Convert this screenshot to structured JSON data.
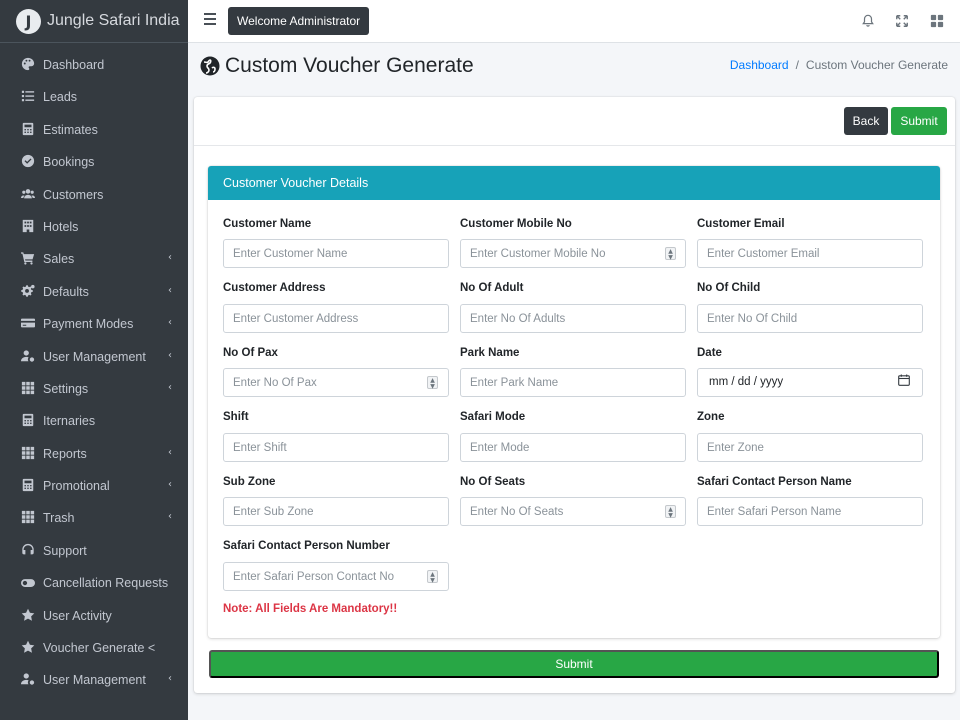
{
  "brand": {
    "logo_letter": "J",
    "name": "Jungle Safari India"
  },
  "sidebar": {
    "items": [
      {
        "label": "Dashboard",
        "icon": "palette-icon",
        "chevron": false
      },
      {
        "label": "Leads",
        "icon": "list-icon",
        "chevron": false
      },
      {
        "label": "Estimates",
        "icon": "calculator-icon",
        "chevron": false
      },
      {
        "label": "Bookings",
        "icon": "check-circle-icon",
        "chevron": false
      },
      {
        "label": "Customers",
        "icon": "users-icon",
        "chevron": false
      },
      {
        "label": "Hotels",
        "icon": "building-icon",
        "chevron": false
      },
      {
        "label": "Sales",
        "icon": "cart-icon",
        "chevron": true
      },
      {
        "label": "Defaults",
        "icon": "cogs-icon",
        "chevron": true
      },
      {
        "label": "Payment Modes",
        "icon": "credit-card-icon",
        "chevron": true
      },
      {
        "label": "User Management",
        "icon": "user-gear-icon",
        "chevron": true
      },
      {
        "label": "Settings",
        "icon": "grid-icon",
        "chevron": true
      },
      {
        "label": "Iternaries",
        "icon": "calculator-icon",
        "chevron": false
      },
      {
        "label": "Reports",
        "icon": "grid-icon",
        "chevron": true
      },
      {
        "label": "Promotional",
        "icon": "calculator-icon",
        "chevron": true
      },
      {
        "label": "Trash",
        "icon": "grid-icon",
        "chevron": true
      },
      {
        "label": "Support",
        "icon": "headset-icon",
        "chevron": false
      },
      {
        "label": "Cancellation Requests",
        "icon": "toggle-icon",
        "chevron": false
      },
      {
        "label": "User Activity",
        "icon": "star-icon",
        "chevron": false
      },
      {
        "label": "Voucher Generate <",
        "icon": "star-icon",
        "chevron": false
      },
      {
        "label": "User Management",
        "icon": "user-gear-icon",
        "chevron": true
      }
    ],
    "chevron_glyph": "‹"
  },
  "topbar": {
    "welcome": "Welcome Administrator"
  },
  "page": {
    "title": "Custom Voucher Generate"
  },
  "breadcrumb": {
    "home": "Dashboard",
    "separator": "/",
    "current": "Custom Voucher Generate"
  },
  "actions": {
    "back": "Back",
    "submit": "Submit"
  },
  "form": {
    "header": "Customer Voucher Details",
    "customer_name": {
      "label": "Customer Name",
      "placeholder": "Enter Customer Name"
    },
    "customer_mobile": {
      "label": "Customer Mobile No",
      "placeholder": "Enter Customer Mobile No"
    },
    "customer_email": {
      "label": "Customer Email",
      "placeholder": "Enter Customer Email"
    },
    "customer_address": {
      "label": "Customer Address",
      "placeholder": "Enter Customer Address"
    },
    "no_of_adult": {
      "label": "No Of Adult",
      "placeholder": "Enter No Of Adults"
    },
    "no_of_child": {
      "label": "No Of Child",
      "placeholder": "Enter No Of Child"
    },
    "no_of_pax": {
      "label": "No Of Pax",
      "placeholder": "Enter No Of Pax"
    },
    "park_name": {
      "label": "Park Name",
      "placeholder": "Enter Park Name"
    },
    "date": {
      "label": "Date",
      "value": "mm / dd / yyyy"
    },
    "shift": {
      "label": "Shift",
      "placeholder": "Enter Shift"
    },
    "safari_mode": {
      "label": "Safari Mode",
      "placeholder": "Enter Mode"
    },
    "zone": {
      "label": "Zone",
      "placeholder": "Enter Zone"
    },
    "sub_zone": {
      "label": "Sub Zone",
      "placeholder": "Enter Sub Zone"
    },
    "no_of_seats": {
      "label": "No Of Seats",
      "placeholder": "Enter No Of Seats"
    },
    "safari_person_name": {
      "label": "Safari Contact Person Name",
      "placeholder": "Enter Safari Person Name"
    },
    "safari_person_number": {
      "label": "Safari Contact Person Number",
      "placeholder": "Enter Safari Person Contact No"
    },
    "note": "Note: All Fields Are Mandatory!!",
    "submit": "Submit"
  },
  "colors": {
    "sidebar": "#343a40",
    "accent": "#17a2b8",
    "success": "#28a745",
    "danger": "#dc3545",
    "link": "#007bff"
  }
}
